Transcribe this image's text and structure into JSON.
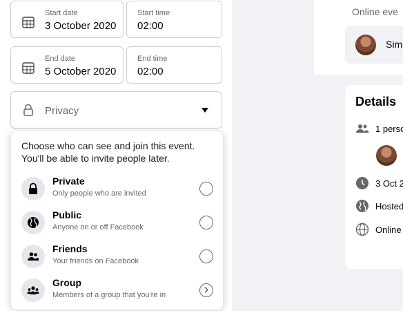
{
  "form": {
    "start_date": {
      "label": "Start date",
      "value": "3 October 2020",
      "icon": "calendar-icon"
    },
    "start_time": {
      "label": "Start time",
      "value": "02:00"
    },
    "end_date": {
      "label": "End date",
      "value": "5 October 2020",
      "icon": "calendar-icon"
    },
    "end_time": {
      "label": "End time",
      "value": "02:00"
    },
    "privacy": {
      "placeholder": "Privacy",
      "icon": "lock-icon"
    }
  },
  "dropdown": {
    "intro": "Choose who can see and join this event. You'll be able to invite people later.",
    "options": [
      {
        "title": "Private",
        "subtitle": "Only people who are invited",
        "icon": "lock-icon",
        "control": "radio"
      },
      {
        "title": "Public",
        "subtitle": "Anyone on or off Facebook",
        "icon": "globe-icon",
        "control": "radio"
      },
      {
        "title": "Friends",
        "subtitle": "Your friends on Facebook",
        "icon": "friends-icon",
        "control": "radio"
      },
      {
        "title": "Group",
        "subtitle": "Members of a group that you're in",
        "icon": "group-icon",
        "control": "chevron-right"
      }
    ]
  },
  "preview": {
    "online_text": "Online eve",
    "host_name": "Sim",
    "details_title": "Details",
    "rows": [
      {
        "icon": "people-icon",
        "text": "1 perso"
      },
      {
        "icon": "clock-icon",
        "text": "3 Oct 2"
      },
      {
        "icon": "globe-icon",
        "text": "Hosted"
      },
      {
        "icon": "web-icon",
        "text": "Online"
      }
    ]
  },
  "colors": {
    "border": "#ccd0d5",
    "secondary_text": "#65676b",
    "icon_bg": "#e4e6eb",
    "page_bg": "#f0f2f5"
  }
}
